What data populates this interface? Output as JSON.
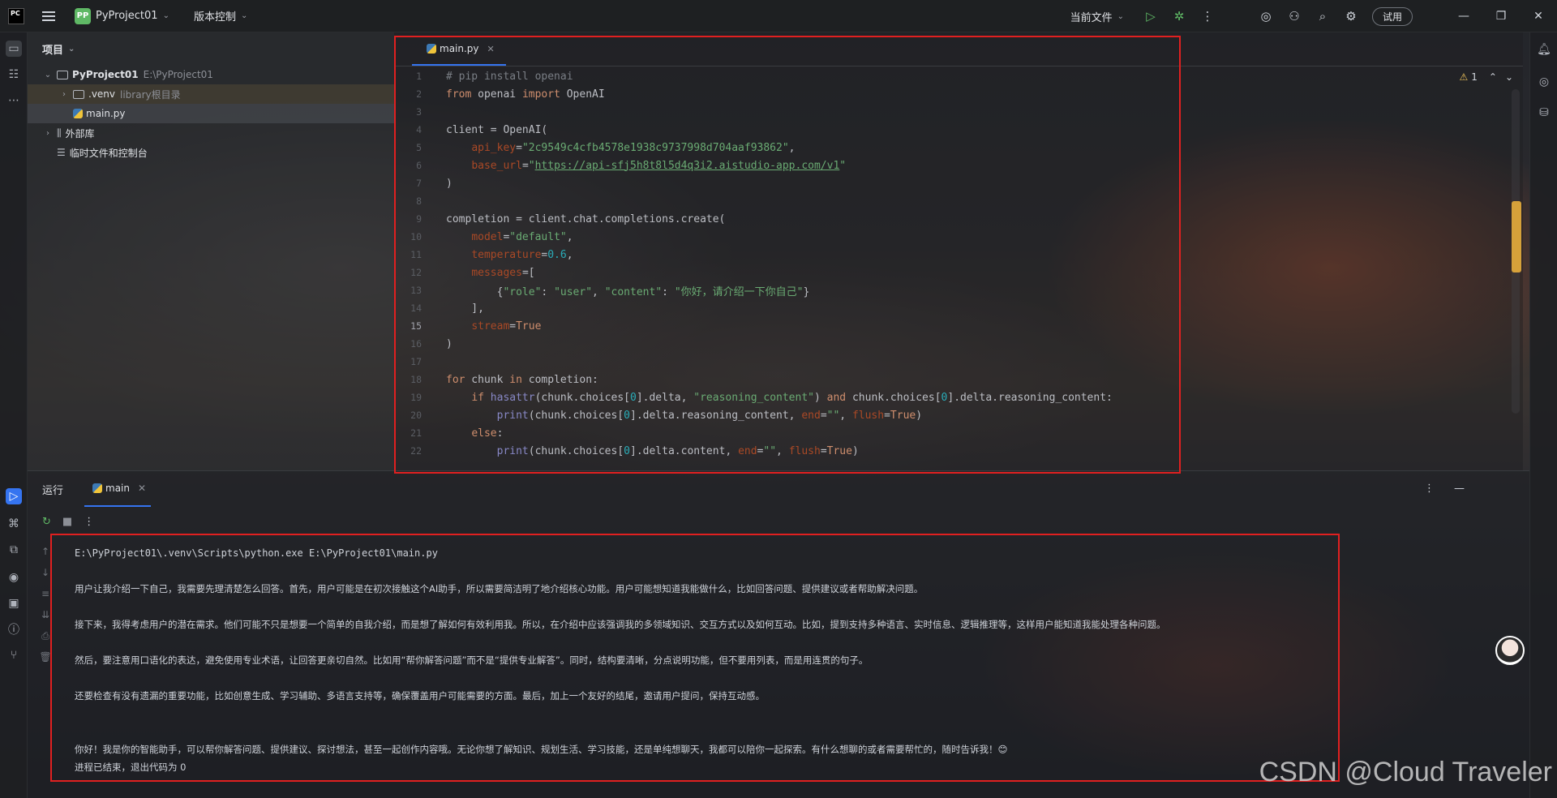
{
  "titlebar": {
    "logo": "PC",
    "project_badge": "PP",
    "project_name": "PyProject01",
    "vcs_label": "版本控制",
    "run_config": "当前文件",
    "try_label": "试用"
  },
  "project_panel": {
    "header": "项目",
    "root_name": "PyProject01",
    "root_path": "E:\\PyProject01",
    "venv_name": ".venv",
    "venv_note": "library根目录",
    "main_file": "main.py",
    "external_libs": "外部库",
    "scratches": "临时文件和控制台"
  },
  "editor": {
    "tab_label": "main.py",
    "warning_count": "1",
    "current_line": 15,
    "lines": [
      "# pip install openai",
      "from openai import OpenAI",
      "",
      "client = OpenAI(",
      "    api_key=\"2c9549c4cfb4578e1938c9737998d704aaf93862\",",
      "    base_url=\"https://api-sfj5h8t8l5d4q3i2.aistudio-app.com/v1\"",
      ")",
      "",
      "completion = client.chat.completions.create(",
      "    model=\"default\",",
      "    temperature=0.6,",
      "    messages=[",
      "        {\"role\": \"user\", \"content\": \"你好，请介绍一下你自己\"}",
      "    ],",
      "    stream=True",
      ")",
      "",
      "for chunk in completion:",
      "    if hasattr(chunk.choices[0].delta, \"reasoning_content\") and chunk.choices[0].delta.reasoning_content:",
      "        print(chunk.choices[0].delta.reasoning_content, end=\"\", flush=True)",
      "    else:",
      "        print(chunk.choices[0].delta.content, end=\"\", flush=True)"
    ]
  },
  "run_panel": {
    "title": "运行",
    "tab_label": "main",
    "console": [
      "E:\\PyProject01\\.venv\\Scripts\\python.exe E:\\PyProject01\\main.py",
      "",
      "用户让我介绍一下自己，我需要先理清楚怎么回答。首先，用户可能是在初次接触这个AI助手，所以需要简洁明了地介绍核心功能。用户可能想知道我能做什么，比如回答问题、提供建议或者帮助解决问题。",
      "",
      "接下来，我得考虑用户的潜在需求。他们可能不只是想要一个简单的自我介绍，而是想了解如何有效利用我。所以，在介绍中应该强调我的多领域知识、交互方式以及如何互动。比如，提到支持多种语言、实时信息、逻辑推理等，这样用户能知道我能处理各种问题。",
      "",
      "然后，要注意用口语化的表达，避免使用专业术语，让回答更亲切自然。比如用“帮你解答问题”而不是“提供专业解答”。同时，结构要清晰，分点说明功能，但不要用列表，而是用连贯的句子。",
      "",
      "还要检查有没有遗漏的重要功能，比如创意生成、学习辅助、多语言支持等，确保覆盖用户可能需要的方面。最后，加上一个友好的结尾，邀请用户提问，保持互动感。",
      "",
      "",
      "你好！我是你的智能助手，可以帮你解答问题、提供建议、探讨想法，甚至一起创作内容哦。无论你想了解知识、规划生活、学习技能，还是单纯想聊天，我都可以陪你一起探索。有什么想聊的或者需要帮忙的，随时告诉我！😊",
      "进程已结束，退出代码为 0"
    ]
  },
  "watermark": "CSDN @Cloud Traveler",
  "colors": {
    "accent": "#3574f0",
    "highlight_box": "#e02020",
    "keyword": "#cf8e6d",
    "string": "#6aab73",
    "number": "#2aacb8"
  },
  "icons": {
    "menu": "hamburger-icon",
    "run": "run-icon",
    "debug": "debug-icon",
    "search": "search-icon",
    "settings": "gear-icon"
  }
}
